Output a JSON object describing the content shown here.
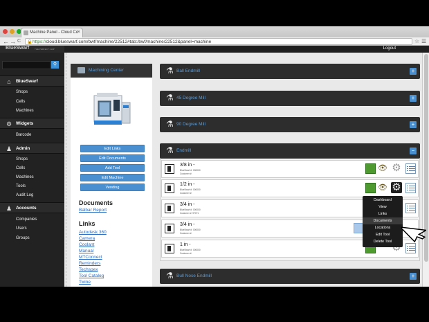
{
  "browser": {
    "tab_title": "Machine Panel - Cloud Co",
    "tab_close": "×",
    "url_scheme": "https://",
    "url_rest": "cloud.blueswarf.com/bwf/machine/22512#tab:/bwf/machine/22512&panel=machine",
    "nav_back": "←",
    "nav_forward": "→",
    "nav_reload": "C"
  },
  "brand": {
    "logo": "BlueSwarf",
    "tagline": "THE PERFECT CHIP"
  },
  "topbar": {
    "logout": "Logout"
  },
  "sidebar": {
    "sections": [
      {
        "label": "BlueSwarf",
        "icon": "home-icon",
        "items": [
          "Shops",
          "Cells",
          "Machines"
        ]
      },
      {
        "label": "Widgets",
        "icon": "gear-icon",
        "items": [
          "Barcode"
        ]
      },
      {
        "label": "Admin",
        "icon": "user-icon",
        "items": [
          "Shops",
          "Cells",
          "Machines",
          "Tools",
          "Audit Log"
        ]
      },
      {
        "label": "Accounts",
        "icon": "users-icon",
        "items": [
          "Companies",
          "Users",
          "Groups"
        ]
      }
    ]
  },
  "machine_card": {
    "title": "Machining Center",
    "buttons": [
      "Edit Links",
      "Edit Documents",
      "Add Tool",
      "Edit Machine",
      "Vending"
    ],
    "documents_heading": "Documents",
    "documents": [
      "Balbar Report"
    ],
    "links_heading": "Links",
    "links": [
      "Autodesk 360",
      "Camera",
      "Coolant",
      "Manual",
      "MTConnect",
      "Reminders",
      "Techspex",
      "Tool Catalog",
      "Twine"
    ]
  },
  "panels": {
    "ball_endmill": "Ball Endmill",
    "deg45": "45 Degree Mill",
    "deg90": "90 Degree Mill",
    "endmill": "Endmill",
    "bull_nose": "Bull Nose Endmill",
    "expand_label": "+",
    "collapse_label": "−"
  },
  "tools": [
    {
      "name": "3/8 in -",
      "serial": "BlueSwarf #: 000000",
      "customer": "Customer #:"
    },
    {
      "name": "1/2 in -",
      "serial": "BlueSwarf #: 000000",
      "customer": "Customer #:"
    },
    {
      "name": "3/4 in -",
      "serial": "BlueSwarf #: 000000",
      "customer": "Customer #: 97071"
    },
    {
      "name": "3/4 in -",
      "serial": "BlueSwarf #: 000000",
      "customer": "Customer #:"
    },
    {
      "name": "1 in -",
      "serial": "BlueSwarf #: 000000",
      "customer": "Customer #:"
    }
  ],
  "tool_menu": {
    "items": [
      "Dashboard",
      "View",
      "Links",
      "Documents",
      "Locations",
      "Edit Tool",
      "Delete Tool"
    ],
    "active": "Documents"
  },
  "colors": {
    "accent": "#4a8fd0",
    "dark_header": "#2d2d2d",
    "status_green": "#4f9a2e",
    "sidebar_bg": "#222222"
  }
}
